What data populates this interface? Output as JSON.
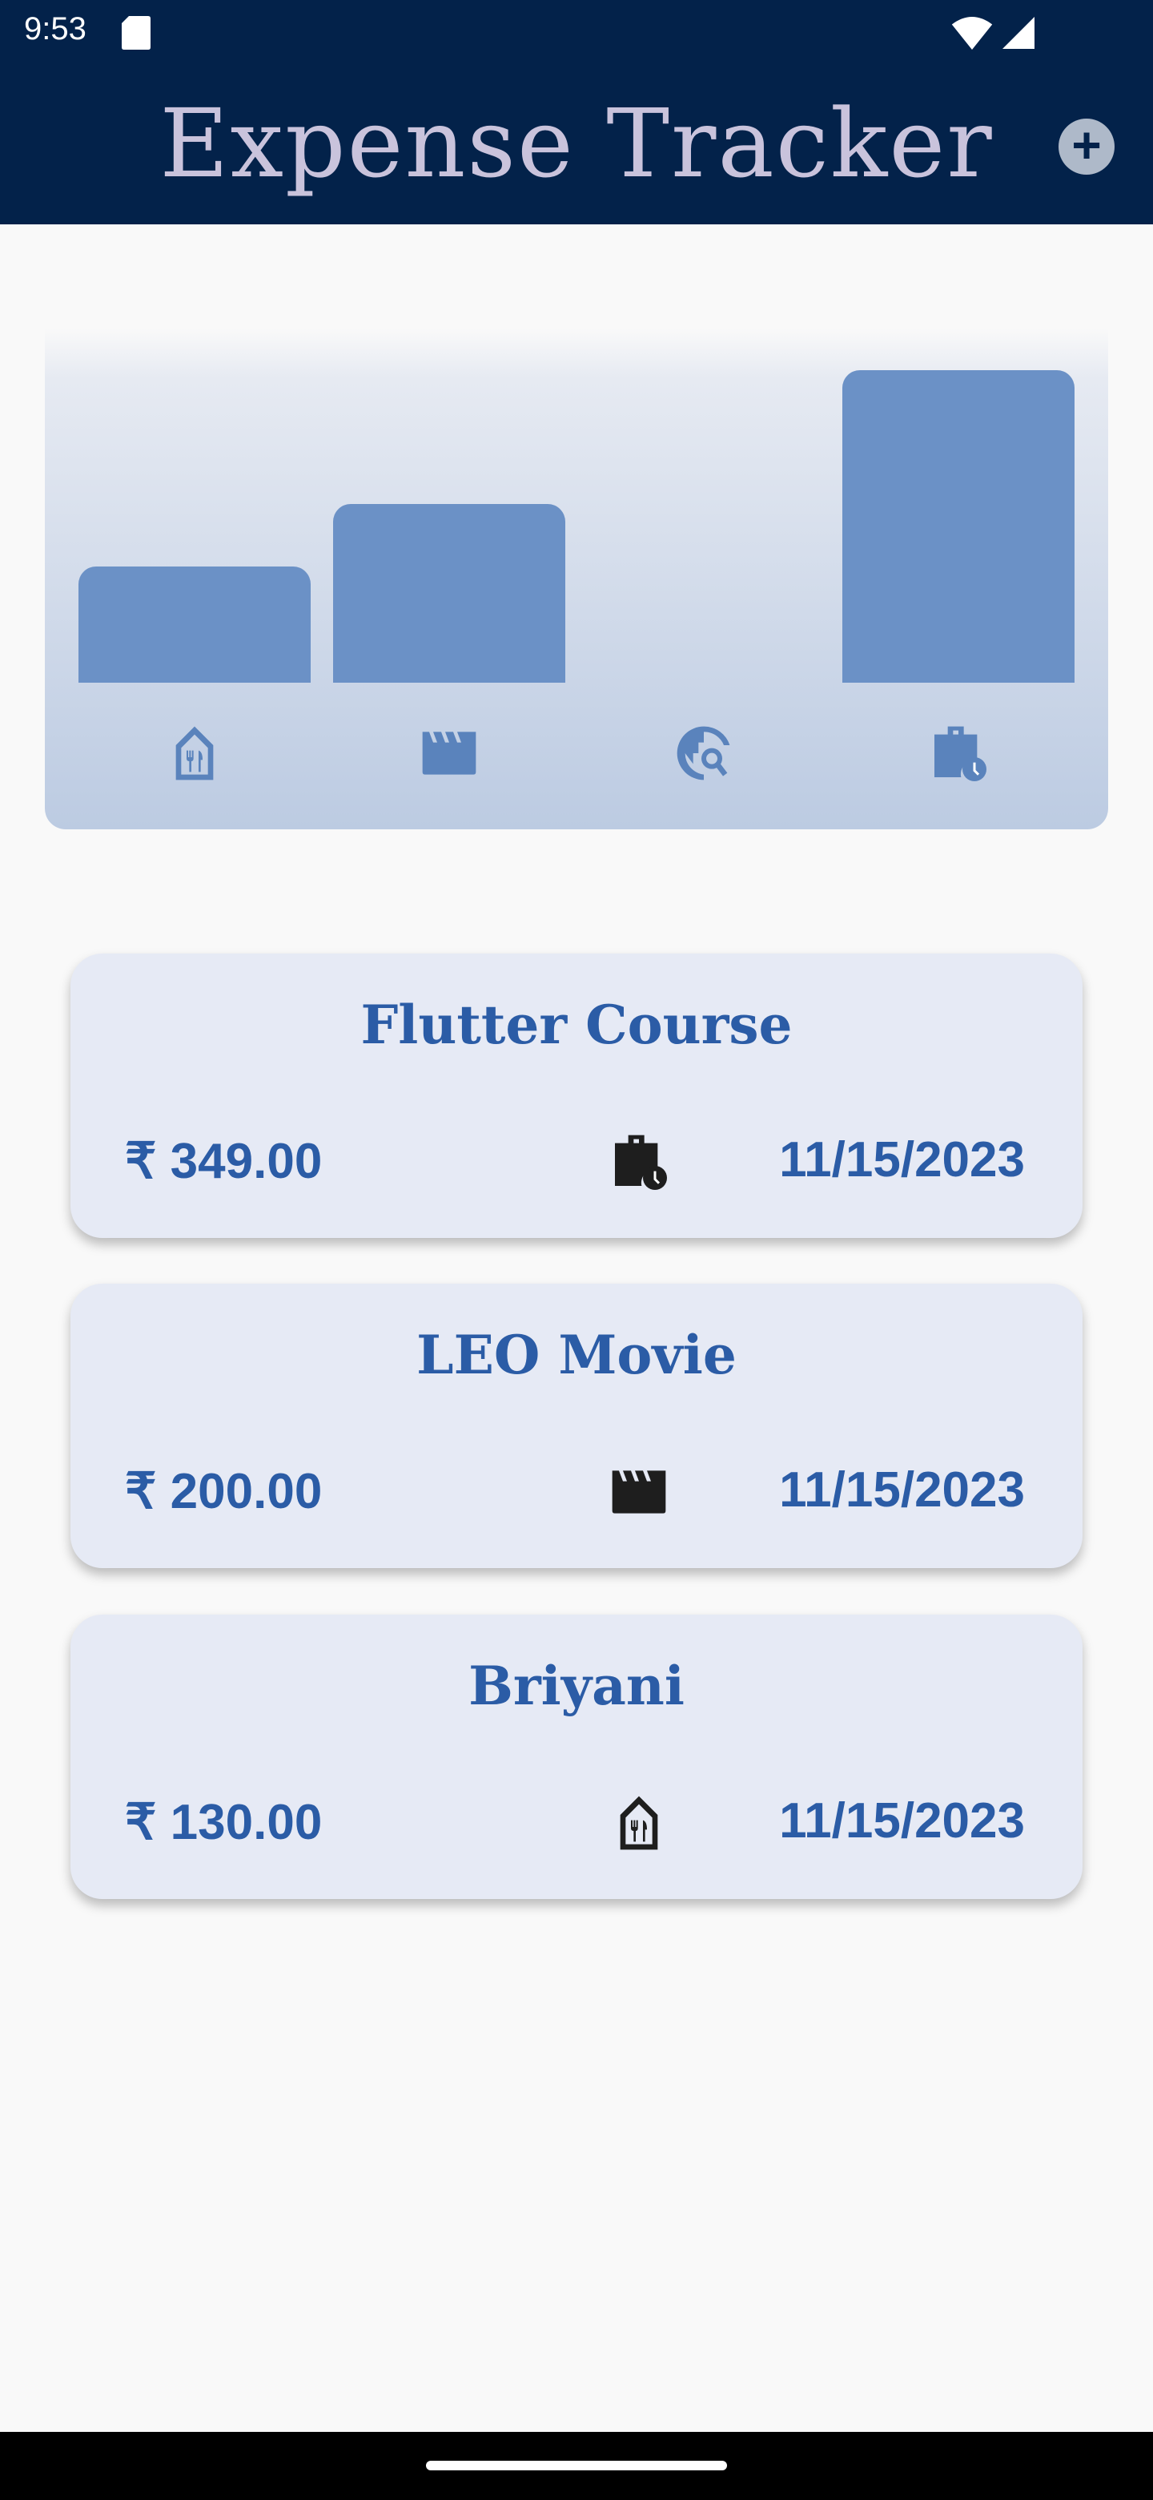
{
  "status_bar": {
    "time": "9:53"
  },
  "app_bar": {
    "title": "Expense Tracker",
    "add_icon": "add-circle-icon"
  },
  "colors": {
    "app_bar": "#03224a",
    "accent": "#2b5ca6",
    "bar": "#6b91c6",
    "card": "#e6eaf5"
  },
  "chart_data": {
    "type": "bar",
    "categories": [
      "food",
      "leisure",
      "travel",
      "work"
    ],
    "category_icons": [
      "restaurant-icon",
      "movie-icon",
      "travel-explore-icon",
      "work-history-icon"
    ],
    "values": [
      130,
      200,
      0,
      349
    ],
    "ylim": [
      0,
      349
    ],
    "grid": false
  },
  "expenses": [
    {
      "title": "Flutter Course",
      "amount": "₹ 349.00",
      "date": "11/15/2023",
      "category": "work",
      "icon": "work-history-icon"
    },
    {
      "title": "LEO Movie",
      "amount": "₹ 200.00",
      "date": "11/15/2023",
      "category": "leisure",
      "icon": "movie-icon"
    },
    {
      "title": "Briyani",
      "amount": "₹ 130.00",
      "date": "11/15/2023",
      "category": "food",
      "icon": "restaurant-icon"
    }
  ]
}
